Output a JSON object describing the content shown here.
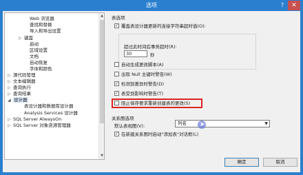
{
  "window": {
    "title": "选项",
    "help": "?",
    "close": "✕"
  },
  "tree": {
    "items": [
      {
        "label": "Web 浏览器",
        "toggle": ""
      },
      {
        "label": "查找和替换",
        "toggle": ""
      },
      {
        "label": "导入和导出设置",
        "toggle": ""
      },
      {
        "label": "键盘",
        "toggle": "▷"
      },
      {
        "label": "启动",
        "toggle": ""
      },
      {
        "label": "区域设置",
        "toggle": ""
      },
      {
        "label": "文档",
        "toggle": ""
      },
      {
        "label": "自动恢复",
        "toggle": ""
      },
      {
        "label": "字体和颜色",
        "toggle": ""
      },
      {
        "label": "源代码管理",
        "toggle": "▷"
      },
      {
        "label": "文本编辑器",
        "toggle": "▷"
      },
      {
        "label": "查询执行",
        "toggle": "▷"
      },
      {
        "label": "查询结果",
        "toggle": "▷"
      },
      {
        "label": "设计器",
        "toggle": "◢"
      },
      {
        "label": "表设计器和数据库设计器",
        "toggle": ""
      },
      {
        "label": "Analysis Services 设计器",
        "toggle": ""
      },
      {
        "label": "SQL Server AlwaysOn",
        "toggle": "▷"
      },
      {
        "label": "SQL Server 对象资源管理器",
        "toggle": "▷"
      }
    ]
  },
  "pane": {
    "table_options_header": "表选项",
    "override_timeout": {
      "label": "覆盖表设计器更新的连接字符串超时值(O):",
      "checked": true
    },
    "timeout_label": "超过此时间后事务超时(R):",
    "timeout_value": "30",
    "timeout_unit": "秒",
    "auto_generate_scripts": {
      "label": "自动生成更改脚本(A)",
      "checked": false
    },
    "warn_null_pk": {
      "label": "出现 Null 主键时警告(W)",
      "checked": false
    },
    "warn_diff_detected": {
      "label": "检测到差异时警告(D)",
      "checked": true
    },
    "warn_tables_affected": {
      "label": "表受到影响时警告(T)",
      "checked": true
    },
    "prevent_save_changes": {
      "label": "阻止保存要求重新创建表的更改(S)",
      "checked": false
    },
    "diagram_options_header": "关系图选项",
    "default_table_view_label": "默认表视图(V):",
    "default_table_view_value": "列名",
    "auto_add_related": {
      "label": "在新建关系图时启动\"添加表\"对话框(L)",
      "checked": true
    }
  },
  "buttons": {
    "ok": "确定",
    "cancel": "取消"
  }
}
